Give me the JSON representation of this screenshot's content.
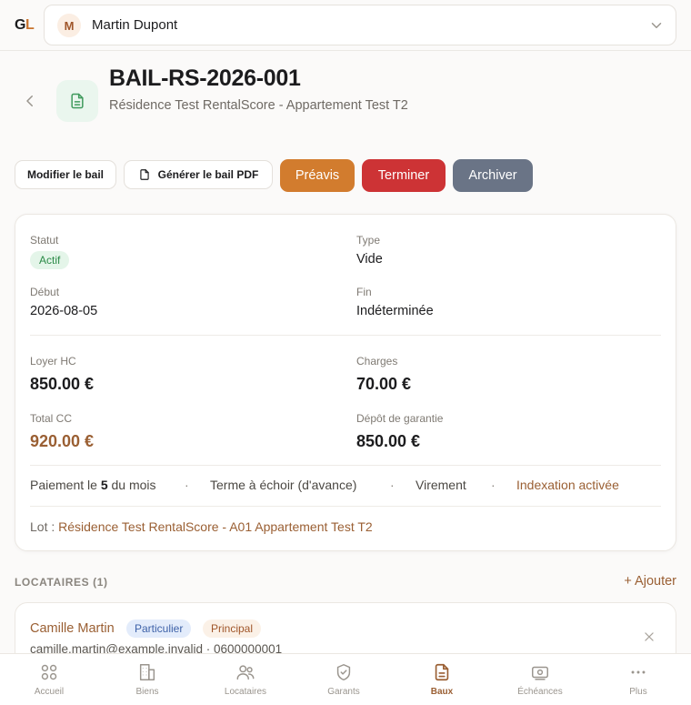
{
  "app": {
    "logo_g": "G",
    "logo_l": "L"
  },
  "user": {
    "initial": "M",
    "name": "Martin Dupont"
  },
  "header": {
    "title": "BAIL-RS-2026-001",
    "subtitle": "Résidence Test RentalScore - Appartement Test T2"
  },
  "actions": {
    "modify": "Modifier le bail",
    "generate_pdf": "Générer le bail PDF",
    "notice": "Préavis",
    "terminate": "Terminer",
    "archive": "Archiver"
  },
  "colors": {
    "accent": "#9a5f33",
    "notice": "#d27c2e",
    "terminate": "#cd3335",
    "archive": "#6a7486"
  },
  "lease": {
    "status_label": "Statut",
    "status_value": "Actif",
    "type_label": "Type",
    "type_value": "Vide",
    "start_label": "Début",
    "start_value": "2026-08-05",
    "end_label": "Fin",
    "end_value": "Indéterminée",
    "rent_label": "Loyer HC",
    "rent_value": "850.00 €",
    "charges_label": "Charges",
    "charges_value": "70.00 €",
    "total_label": "Total CC",
    "total_value": "920.00 €",
    "deposit_label": "Dépôt de garantie",
    "deposit_value": "850.00 €",
    "payment_prefix": "Paiement le",
    "payment_day": "5",
    "payment_suffix": "du mois",
    "term": "Terme à échoir (d'avance)",
    "method": "Virement",
    "indexation": "Indexation activée",
    "separator": "·",
    "lot_label": "Lot :",
    "lot_value": "Résidence Test RentalScore - A01 Appartement Test T2"
  },
  "tenants": {
    "heading": "LOCATAIRES (1)",
    "add": "+ Ajouter",
    "items": [
      {
        "name": "Camille Martin",
        "type": "Particulier",
        "role": "Principal",
        "contact": "camille.martin@example.invalid · 0600000001"
      }
    ]
  },
  "nav": [
    {
      "label": "Accueil",
      "icon": "home-grid-icon"
    },
    {
      "label": "Biens",
      "icon": "building-icon"
    },
    {
      "label": "Locataires",
      "icon": "users-icon"
    },
    {
      "label": "Garants",
      "icon": "shield-icon"
    },
    {
      "label": "Baux",
      "icon": "document-icon",
      "active": true
    },
    {
      "label": "Échéances",
      "icon": "banknote-icon"
    },
    {
      "label": "Plus",
      "icon": "more-icon"
    }
  ]
}
